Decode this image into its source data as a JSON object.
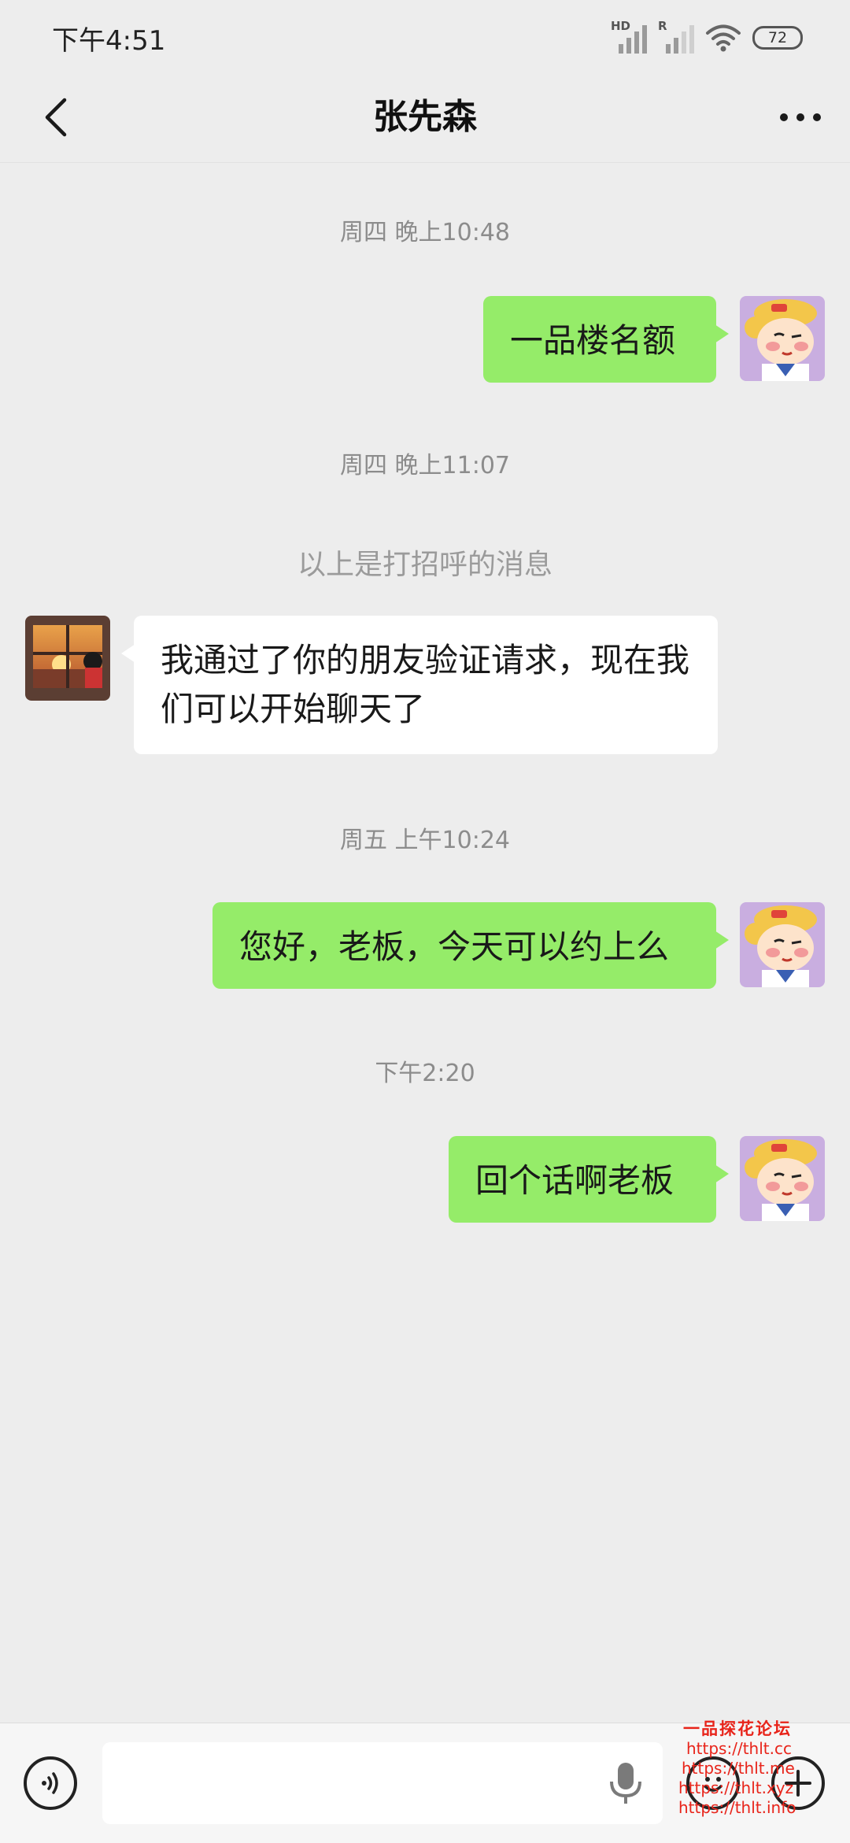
{
  "status_bar": {
    "time": "下午4:51",
    "hd_label": "HD",
    "roaming_label": "R",
    "battery": "72"
  },
  "header": {
    "title": "张先森",
    "back_icon": "chevron-left-icon",
    "more_icon": "more-dots-icon"
  },
  "messages": {
    "t1": "周四 晚上10:48",
    "m1": "一品楼名额",
    "t2": "周四 晚上11:07",
    "system_note": "以上是打招呼的消息",
    "m2": "我通过了你的朋友验证请求，现在我们可以开始聊天了",
    "t3": "周五 上午10:24",
    "m3": "您好，老板，今天可以约上么",
    "t4": "下午2:20",
    "m4": "回个话啊老板"
  },
  "input_bar": {
    "value": "",
    "voice_icon": "voice-mode-icon",
    "mic_icon": "microphone-icon",
    "emoji_icon": "emoji-icon",
    "plus_icon": "plus-icon"
  },
  "watermark": {
    "title": "一品探花论坛",
    "links": [
      "https://thlt.cc",
      "https://thlt.me",
      "https://thlt.xyz",
      "https://thlt.info"
    ]
  },
  "colors": {
    "background": "#ededed",
    "my_bubble": "#95ec69",
    "their_bubble": "#ffffff",
    "watermark": "#e8241a"
  }
}
